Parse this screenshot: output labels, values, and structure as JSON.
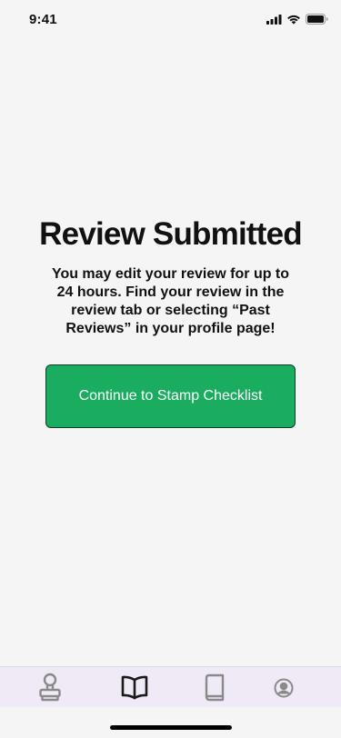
{
  "status_bar": {
    "time": "9:41"
  },
  "confirmation": {
    "title": "Review Submitted",
    "message": "You may edit your review for up to 24 hours. Find your review in the review tab or selecting “Past Reviews” in your profile page!",
    "button_label": "Continue to Stamp Checklist"
  },
  "tab_bar": {
    "items": [
      {
        "icon": "stamp-icon",
        "active": false
      },
      {
        "icon": "open-book-icon",
        "active": true
      },
      {
        "icon": "book-icon",
        "active": false
      },
      {
        "icon": "profile-icon",
        "active": false
      }
    ]
  },
  "colors": {
    "background": "#f5f5f5",
    "primary_button": "#1aad5f",
    "tab_bar_background": "#f0eaf6",
    "icon_active": "#1a1a1a",
    "icon_inactive": "#8a8a8a"
  }
}
